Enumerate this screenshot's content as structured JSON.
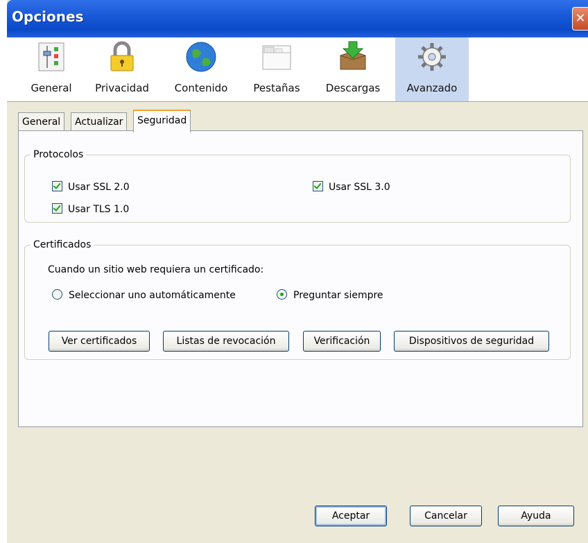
{
  "window": {
    "title": "Opciones",
    "close_symbol": "✕"
  },
  "toolbar": {
    "items": [
      {
        "label": "General",
        "icon": "sliders-icon"
      },
      {
        "label": "Privacidad",
        "icon": "padlock-icon"
      },
      {
        "label": "Contenido",
        "icon": "globe-icon"
      },
      {
        "label": "Pestañas",
        "icon": "tabs-window-icon"
      },
      {
        "label": "Descargas",
        "icon": "download-box-icon"
      },
      {
        "label": "Avanzado",
        "icon": "gear-icon",
        "active": true
      }
    ]
  },
  "subtabs": [
    "General",
    "Actualizar",
    "Seguridad"
  ],
  "selected_subtab": "Seguridad",
  "protocolos": {
    "legend": "Protocolos",
    "ssl2": "Usar SSL 2.0",
    "ssl3": "Usar SSL 3.0",
    "tls1": "Usar TLS 1.0",
    "checked": [
      true,
      true,
      true
    ]
  },
  "certificados": {
    "legend": "Certificados",
    "prompt": "Cuando un sitio web requiera un certificado:",
    "radio_auto": "Seleccionar uno automáticamente",
    "radio_ask": "Preguntar siempre",
    "selected": "Preguntar siempre",
    "buttons": {
      "ver": "Ver certificados",
      "listas": "Listas de revocación",
      "verificacion": "Verificación",
      "dispositivos": "Dispositivos de seguridad"
    }
  },
  "footer": {
    "accept": "Aceptar",
    "cancel": "Cancelar",
    "help": "Ayuda"
  },
  "colors": {
    "titlebar": "#0a49c8",
    "active_tool": "#c8d8f0",
    "tab_highlight": "#f0a030",
    "check": "#21a121"
  }
}
